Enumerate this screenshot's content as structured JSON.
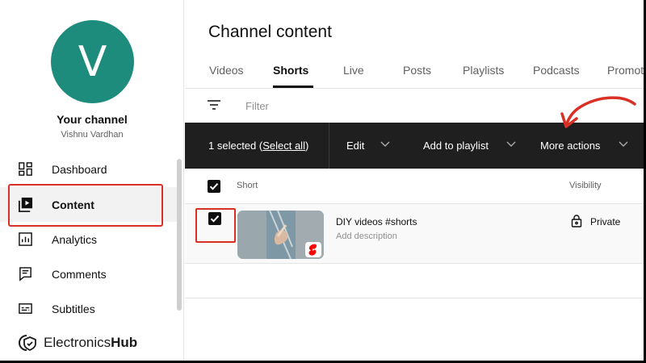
{
  "channel": {
    "avatar_letter": "V",
    "title": "Your channel",
    "owner": "Vishnu Vardhan"
  },
  "sidebar": {
    "items": [
      {
        "label": "Dashboard",
        "icon": "dashboard-icon"
      },
      {
        "label": "Content",
        "icon": "content-icon",
        "active": true
      },
      {
        "label": "Analytics",
        "icon": "analytics-icon"
      },
      {
        "label": "Comments",
        "icon": "comments-icon"
      },
      {
        "label": "Subtitles",
        "icon": "subtitles-icon"
      }
    ]
  },
  "watermark": {
    "brand_light": "Electronics",
    "brand_bold": "Hub"
  },
  "page": {
    "title": "Channel content"
  },
  "tabs": [
    "Videos",
    "Shorts",
    "Live",
    "Posts",
    "Playlists",
    "Podcasts",
    "Promotions"
  ],
  "filter": {
    "label": "Filter",
    "icon": "filter-icon"
  },
  "action_bar": {
    "selected_prefix": "1 selected (",
    "select_all": "Select all",
    "selected_suffix": ")",
    "edit": "Edit",
    "add_to_playlist": "Add to playlist",
    "more_actions": "More actions"
  },
  "list": {
    "col_short": "Short",
    "col_visibility": "Visibility",
    "rows": [
      {
        "title": "DIY videos #shorts",
        "description": "Add description",
        "visibility": "Private",
        "selected": true
      }
    ]
  },
  "colors": {
    "avatar": "#1e8c7c",
    "highlight": "#d93025",
    "action_bar": "#1f1f1f",
    "shorts_badge": "#ff0000"
  }
}
